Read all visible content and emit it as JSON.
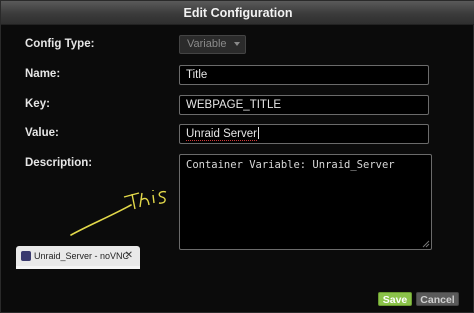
{
  "dialog": {
    "title": "Edit Configuration"
  },
  "fields": {
    "config_type": {
      "label": "Config Type:",
      "value": "Variable"
    },
    "name": {
      "label": "Name:",
      "value": "Title"
    },
    "key": {
      "label": "Key:",
      "value": "WEBPAGE_TITLE"
    },
    "value": {
      "label": "Value:",
      "value": "Unraid Server"
    },
    "description": {
      "label": "Description:",
      "value": "Container Variable: Unraid_Server"
    }
  },
  "annotation": {
    "text": "This",
    "color": "#e3d94a"
  },
  "browser_tab": {
    "title": "Unraid_Server - noVNC",
    "close": "✕"
  },
  "buttons": {
    "save": "Save",
    "cancel": "Cancel"
  },
  "colors": {
    "save_bg": "#8bc34a",
    "cancel_bg": "#5a5a5a",
    "titlebar": "#3b3b3b"
  }
}
